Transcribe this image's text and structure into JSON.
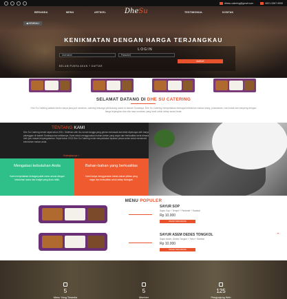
{
  "topbar": {
    "socials": [
      "facebook-icon",
      "twitter-icon",
      "google-plus-icon",
      "instagram-icon"
    ],
    "email": "dhesu.catering@gmail.com",
    "phone": "0821-3367-9999"
  },
  "nav": {
    "items": [
      "BERANDA",
      "MENU",
      "ARTIKEL",
      "TESTIMONIAL",
      "KONTAK"
    ],
    "logo_left": "Dhe",
    "logo_right": "Su"
  },
  "hero": {
    "back_label": "◀ KEMBALI",
    "title": "KENIKMATAN DENGAN HARGA TERJANGKAU",
    "login_title": "LOGIN",
    "username_placeholder": "Username",
    "password_placeholder": "Password",
    "submit_label": "MASUK",
    "register_text": "BELUM PUNYA AKUN ? DAFTAR"
  },
  "welcome": {
    "title_prefix": "SELAMAT DATANG DI",
    "title_highlight": "DHE SU CATERING",
    "text": "Dhe Su Catering adalah kantor karya jasa jual rumahan, catering keluarga pendukung acara di daerah Surabaya. Dhe Su Catering menyediakan berbagai kebutuhan makan siang, prasmanan, nasi kotak dan tumpeng dengan harga terjangkau dan cita rasa rumahan yang lezat untuk setiap acara Anda."
  },
  "about": {
    "title_prefix": "TENTANG",
    "title_highlight": "KAMI",
    "text": "Dhe Su Catering berdiri sejak tahun 2011. Didirikan oleh ibu rumah tangga yang gemar memasak dan telah dipercaya oleh banyak pelanggan di daerah Surabaya dan sekitarnya. Kami selalu menggunakan bahan-bahan yang segar dan berkualitas serta dimasak oleh juru masak berpengalaman. Sejak tahun 2013 Dhe Su Catering mulai menyediakan layanan pesan antar untuk memenuhi kebutuhan makan anda.",
    "more": "Selengkapnya »"
  },
  "features": [
    {
      "title": "Mengatasi kebutuhan Anda",
      "text": "Kami menyediakan berbagai paket menu sesuai dengan kebutuhan acara dan budget yang Anda miliki."
    },
    {
      "title": "Bahan-bahan yang berkualitas",
      "text": "Kami hanya menggunakan bahan-bahan pilihan yang segar dan berkualitas untuk setiap hidangan."
    }
  ],
  "menu": {
    "title_prefix": "MENU",
    "title_highlight": "POPULER",
    "items": [
      {
        "name": "SAYUR SOP",
        "desc": "Sayur Sop + Tempe + Perkedel + Sambal",
        "price": "Rp 10.000",
        "button": "PESAN SEKARANG"
      },
      {
        "name": "SAYUR ASEM DEDES TONGKOL",
        "desc": "Sayur Asem, Dedes Tongkol + Tahu + Sambal",
        "price": "Rp 10.000",
        "button": "PESAN SEKARANG"
      }
    ]
  },
  "stats": [
    {
      "icon": "fork-icon",
      "number": "5",
      "label": "Menu Yang Tersedia"
    },
    {
      "icon": "user-icon",
      "number": "5",
      "label": "Member"
    },
    {
      "icon": "cart-icon",
      "number": "125",
      "label": "Pengunjung Web"
    }
  ],
  "colors": {
    "accent": "#e8522d",
    "green": "#2fc08a",
    "dark": "#1f1f1f",
    "plate": "#6a2f75"
  }
}
